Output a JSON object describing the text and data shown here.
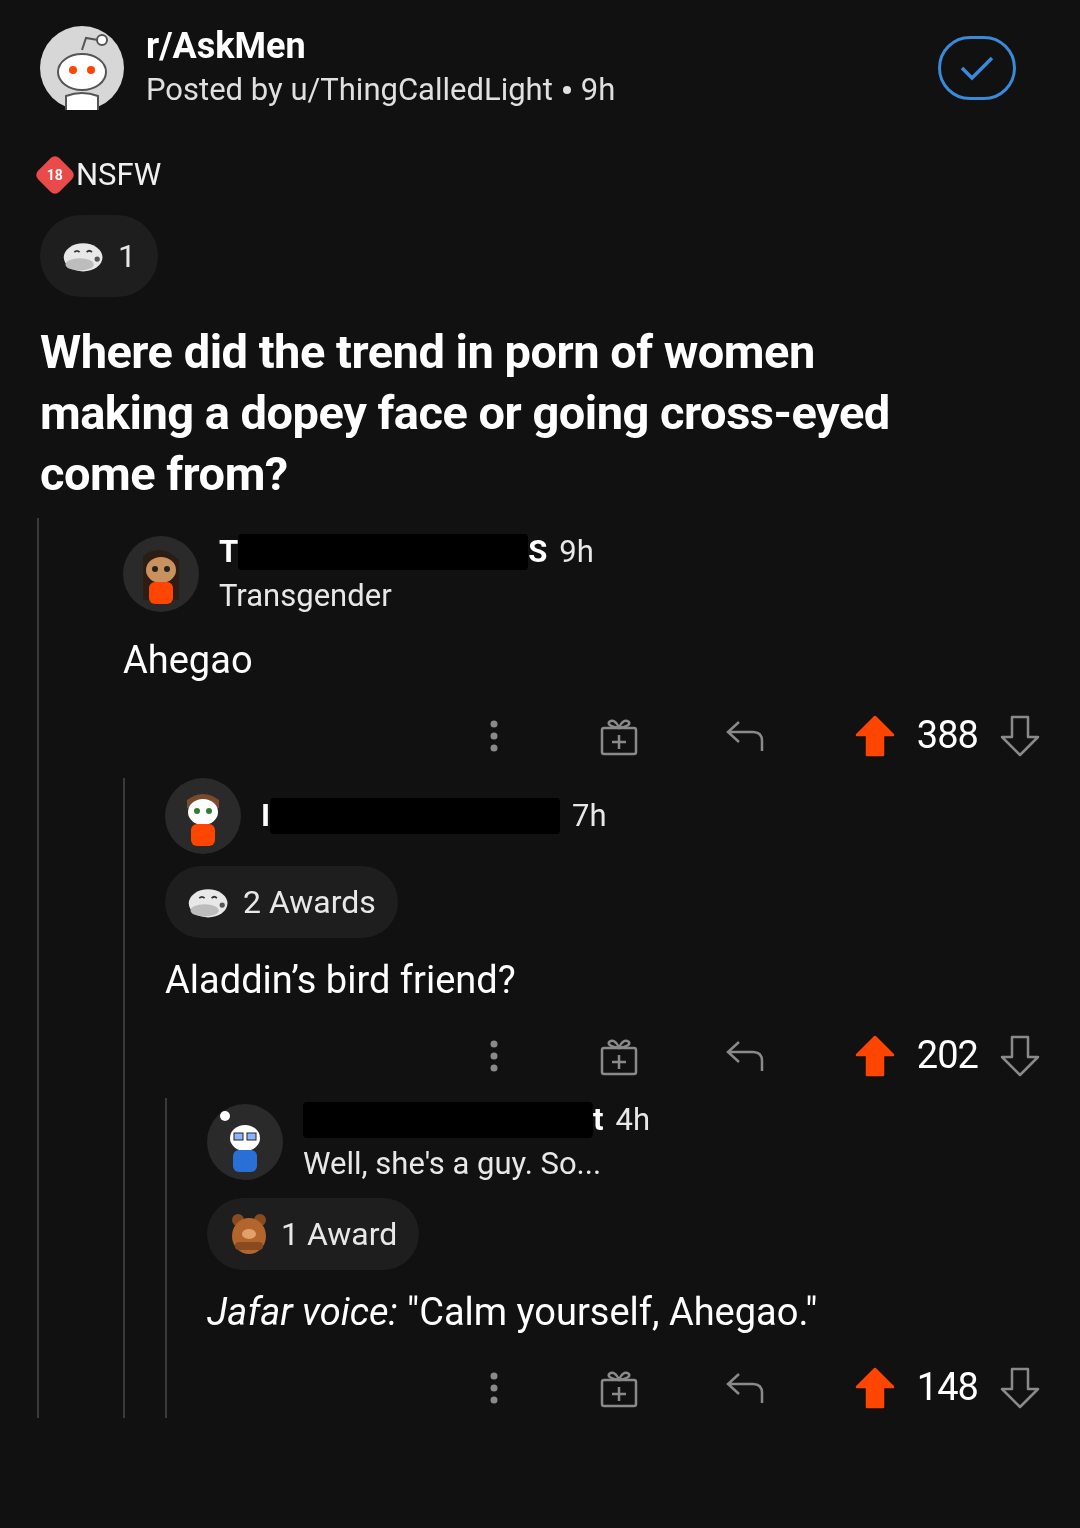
{
  "post": {
    "subreddit": "r/AskMen",
    "byline": "Posted by u/ThingCalledLight",
    "time": "9h",
    "joined": true,
    "nsfw_badge": "18",
    "nsfw_label": "NSFW",
    "award_count": "1",
    "title": "Where did the trend in porn of women making a dopey face or going cross-eyed come from?"
  },
  "comments": [
    {
      "name_start": "T",
      "name_end": "S",
      "time": "9h",
      "flair": "Transgender",
      "body": "Ahegao",
      "votes": "388",
      "upvoted": true,
      "children": [
        {
          "name_start": "I",
          "time": "7h",
          "awards": {
            "label": "2 Awards"
          },
          "body": "Aladdin’s bird friend?",
          "votes": "202",
          "upvoted": true,
          "children": [
            {
              "name_end": "t",
              "time": "4h",
              "flair": "Well, she's a guy. So...",
              "awards": {
                "label": "1 Award"
              },
              "body": "*Jafar voice:* \"Calm yourself, Ahegao.\"",
              "votes": "148",
              "upvoted": true
            }
          ]
        }
      ]
    }
  ]
}
